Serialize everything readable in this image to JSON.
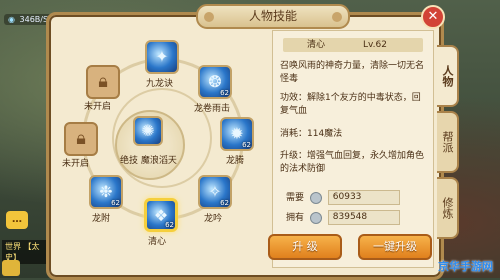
{
  "status_bar": {
    "speed": "346B/S"
  },
  "window": {
    "title": "人物技能",
    "close_glyph": "✕"
  },
  "side_tabs": [
    {
      "label": "人物",
      "active": true
    },
    {
      "label": "帮派",
      "active": false
    },
    {
      "label": "修炼",
      "active": false
    }
  ],
  "center_skill": {
    "label": "绝技 魔浪滔天"
  },
  "skills": [
    {
      "label": "九龙诀",
      "level": "",
      "locked": false,
      "selected": false
    },
    {
      "label": "龙卷雨击",
      "level": "62",
      "locked": false,
      "selected": false
    },
    {
      "label": "龙腾",
      "level": "62",
      "locked": false,
      "selected": false
    },
    {
      "label": "龙吟",
      "level": "62",
      "locked": false,
      "selected": false
    },
    {
      "label": "清心",
      "level": "62",
      "locked": false,
      "selected": true
    },
    {
      "label": "龙附",
      "level": "62",
      "locked": false,
      "selected": false
    },
    {
      "label": "未开启",
      "level": "",
      "locked": true,
      "selected": false
    },
    {
      "label": "未开启",
      "level": "",
      "locked": true,
      "selected": false
    }
  ],
  "detail": {
    "name": "清心",
    "level": "Lv.62",
    "description": "召唤风雨的神奇力量，清除一切无名怪毒",
    "effect": "功效：解除1个友方的中毒状态，回复气血",
    "cost": "消耗：114魔法",
    "upgrade": "升级：增强气血回复，永久增加角色的法术防御",
    "required_label": "需要",
    "required_value": "60933",
    "owned_label": "拥有",
    "owned_value": "839548"
  },
  "buttons": {
    "upgrade": "升 级",
    "one_key_upgrade": "一键升级"
  },
  "left_hud": {
    "world": "世界 【太史】"
  },
  "watermark": "京华手游网"
}
